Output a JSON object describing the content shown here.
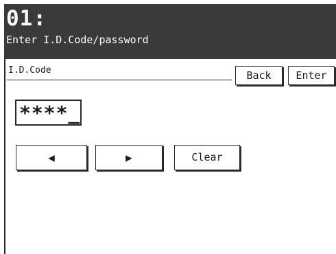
{
  "header": {
    "number": "01:",
    "message": "Enter I.D.Code/password"
  },
  "field": {
    "label": "I.D.Code",
    "value": "****_"
  },
  "buttons": {
    "back": "Back",
    "enter": "Enter",
    "clear": "Clear"
  },
  "icons": {
    "left": "left-arrow-icon",
    "right": "right-arrow-icon"
  },
  "arrow_glyphs": {
    "left": "◀",
    "right": "▶"
  }
}
